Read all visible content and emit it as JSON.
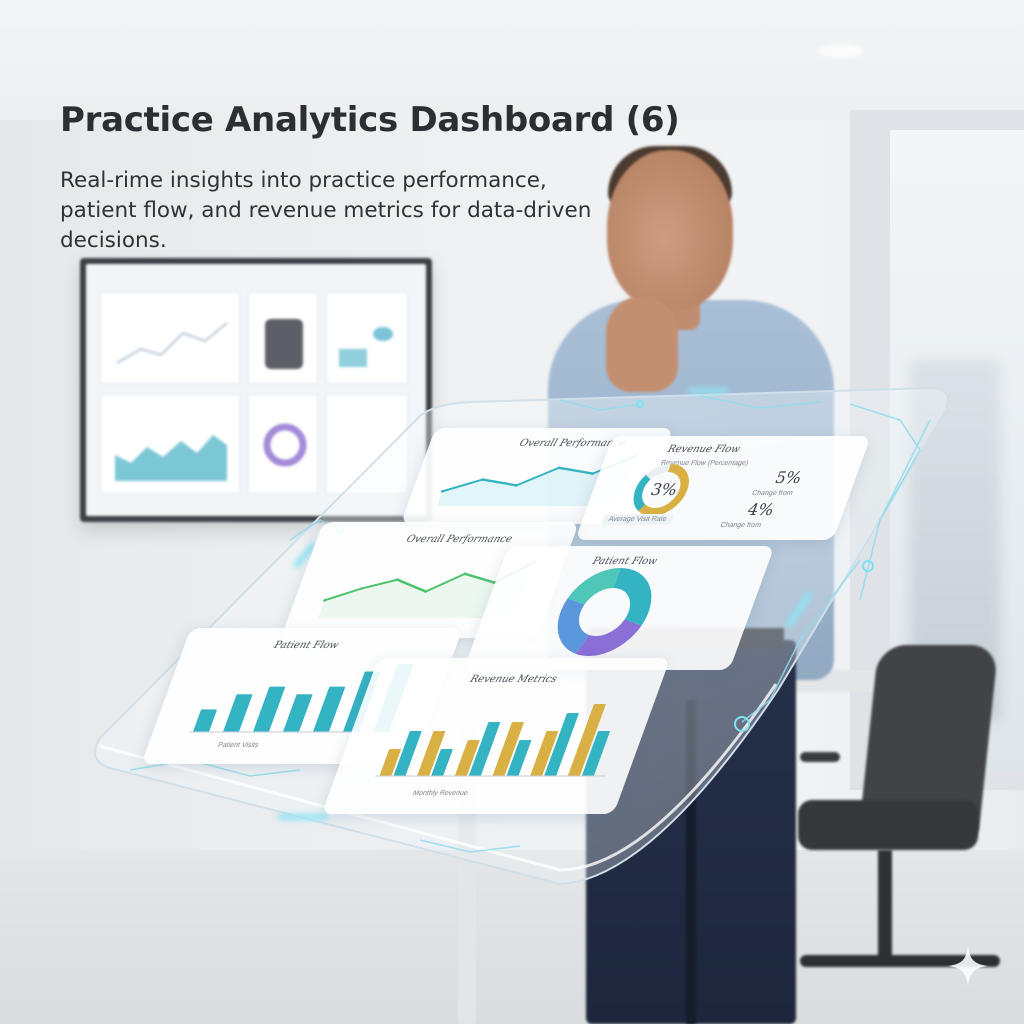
{
  "header": {
    "title": "Practice Analytics Dashboard (6)",
    "subtitle": "Real-rime insights into practice performance, patient flow, and revenue metrics for data-driven decisions."
  },
  "panel": {
    "cards": {
      "overall_top": {
        "title": "Overall Performance"
      },
      "revenue_flow": {
        "title": "Revenue Flow",
        "subtitle": "Revenue Flow (Percentage)",
        "donut_label": "3%",
        "stat_1": "5%",
        "stat_1_caption": "Change from",
        "stat_2": "4%",
        "stat_2_caption": "Change from",
        "pill": "Average Visit Rate"
      },
      "overall_main": {
        "title": "Overall Performance"
      },
      "patient_flow_donut": {
        "title": "Patient Flow"
      },
      "patient_flow_bars": {
        "title": "Patient Flow",
        "footer": "Patient Visits"
      },
      "revenue_metrics": {
        "title": "Revenue Metrics",
        "footer": "Monthly Revenue"
      }
    }
  },
  "colors": {
    "teal": "#34b3c3",
    "green": "#4cc26a",
    "gold": "#d8b043",
    "purple": "#8a6fd6",
    "blue": "#5a97dc",
    "accent_glow": "#7fe0f2"
  },
  "chart_data": [
    {
      "type": "line",
      "title": "Overall Performance",
      "values": [
        10,
        18,
        14,
        26,
        22,
        34
      ]
    },
    {
      "type": "pie",
      "title": "Revenue Flow",
      "values": [
        60,
        25,
        15
      ]
    },
    {
      "type": "line",
      "title": "Overall Performance",
      "values": [
        12,
        20,
        26,
        18,
        30,
        24,
        38
      ]
    },
    {
      "type": "pie",
      "title": "Patient Flow",
      "values": [
        30,
        25,
        25,
        20
      ]
    },
    {
      "type": "bar",
      "title": "Patient Flow",
      "values": [
        3,
        5,
        6,
        5,
        6,
        8,
        9
      ]
    },
    {
      "type": "bar",
      "title": "Revenue Metrics",
      "series": [
        {
          "values": [
            3,
            5,
            4,
            6,
            5,
            8
          ]
        },
        {
          "values": [
            5,
            3,
            6,
            4,
            7,
            5
          ]
        }
      ]
    }
  ]
}
